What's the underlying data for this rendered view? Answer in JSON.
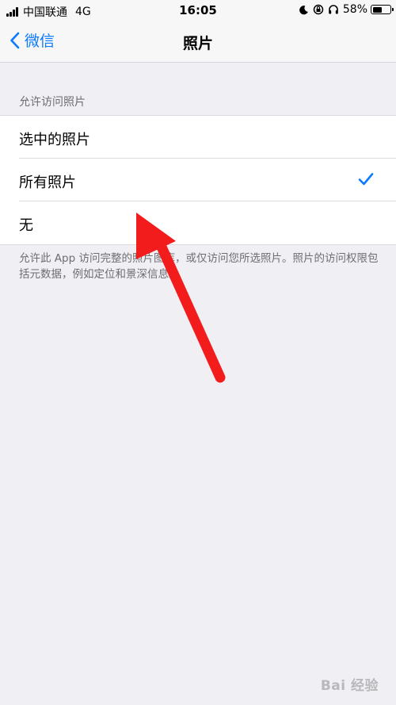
{
  "status_bar": {
    "carrier": "中国联通",
    "network": "4G",
    "time": "16:05",
    "battery_percent": "58%",
    "battery_level": 0.58
  },
  "nav": {
    "back_label": "微信",
    "title": "照片"
  },
  "section": {
    "header": "允许访问照片",
    "options": [
      {
        "label": "选中的照片",
        "selected": false
      },
      {
        "label": "所有照片",
        "selected": true
      },
      {
        "label": "无",
        "selected": false
      }
    ],
    "footer": "允许此 App 访问完整的照片图库，或仅访问您所选照片。照片的访问权限包括元数据，例如定位和景深信息。"
  },
  "colors": {
    "accent": "#0a7aff",
    "annotation_arrow": "#f21c1c",
    "background": "#efeff4"
  },
  "watermark": {
    "text": "Bai 经验"
  }
}
